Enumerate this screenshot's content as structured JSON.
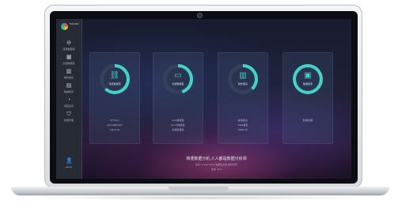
{
  "app": {
    "logo_title": "Sunyard",
    "logo_subtitle": ""
  },
  "sidebar": {
    "items": [
      {
        "icon": "link-icon",
        "glyph": "⊖",
        "label": "连接数据源"
      },
      {
        "icon": "calendar-icon",
        "glyph": "▦",
        "label": "创建数据集"
      },
      {
        "icon": "chart-icon",
        "glyph": "▥",
        "label": "制作报表"
      },
      {
        "icon": "message-icon",
        "glyph": "▤",
        "label": "数据探索"
      },
      {
        "icon": "clock-icon",
        "glyph": "◔",
        "label": "调度任务"
      },
      {
        "icon": "shield-icon",
        "glyph": "⛉",
        "label": "权限管理"
      }
    ],
    "user": {
      "glyph": "👤",
      "label": "admin"
    }
  },
  "cards": [
    {
      "glyph": "⛓",
      "title": "连接数据源",
      "items": [
        "MYSQL",
        "SQLSERVER",
        "ORACLE"
      ]
    },
    {
      "glyph": "▭",
      "title": "创建数据集",
      "items": [
        "SQL数据集",
        "Excel数据集",
        "关联数据集"
      ]
    },
    {
      "glyph": "▥",
      "title": "制作报表",
      "items": [
        "拖拽报表",
        "WEB报表",
        "WEB 3D"
      ]
    },
    {
      "glyph": "▣",
      "title": "数据探索",
      "items": [
        "数据地图"
      ]
    }
  ],
  "footer": {
    "title": "简便数据分析,人人都是数据分析师",
    "subtitle": "版权 © 2017-2018 信雅达系统 版权所有",
    "version": "版本 V1.0"
  },
  "colors": {
    "accent": "#3fd6c8",
    "sidebar": "#272b33"
  }
}
